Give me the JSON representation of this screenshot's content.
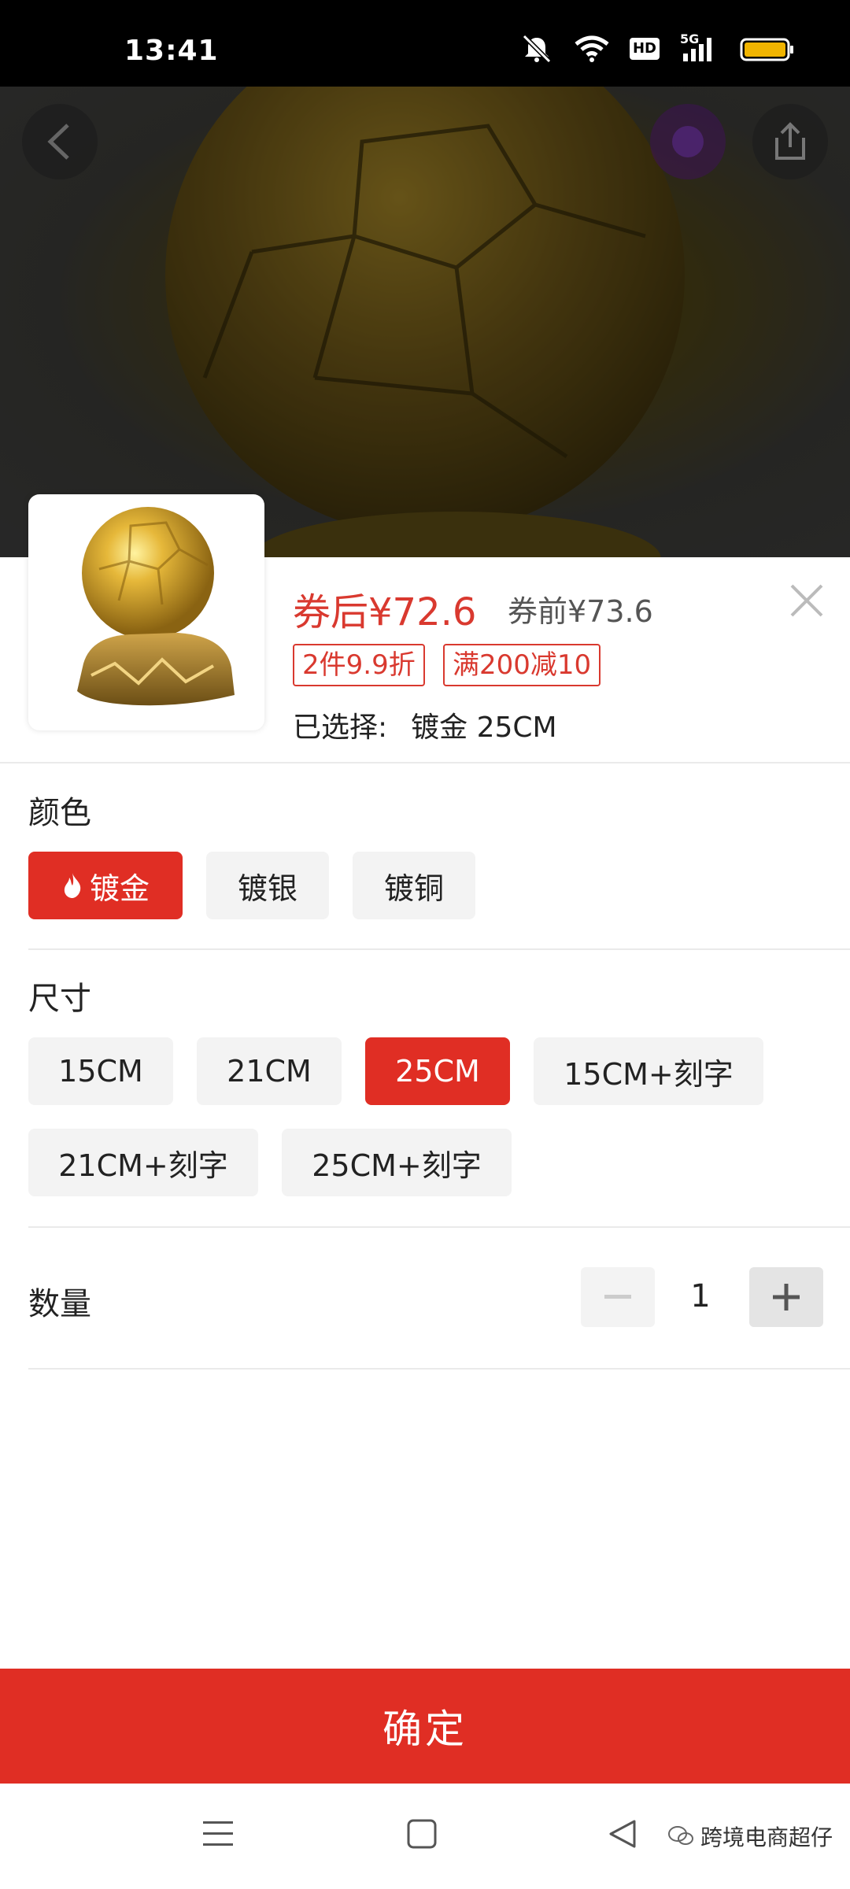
{
  "status_bar": {
    "time": "13:41",
    "icons": [
      "mute-icon",
      "wifi-icon",
      "hd-icon",
      "signal-5g-icon",
      "battery-icon"
    ],
    "hd_label": "HD",
    "net_label": "5G"
  },
  "hero": {
    "icons": [
      "back-icon",
      "brand-icon",
      "share-icon"
    ]
  },
  "product": {
    "price_after": "券后¥72.6",
    "price_before": "券前¥73.6",
    "promos": [
      "2件9.9折",
      "满200减10"
    ],
    "selected_label": "已选择:",
    "selected_value": "镀金 25CM"
  },
  "color_section": {
    "title": "颜色",
    "options": [
      "镀金",
      "镀银",
      "镀铜"
    ],
    "selected": "镀金"
  },
  "size_section": {
    "title": "尺寸",
    "options": [
      "15CM",
      "21CM",
      "25CM",
      "15CM+刻字",
      "21CM+刻字",
      "25CM+刻字"
    ],
    "selected": "25CM"
  },
  "quantity": {
    "label": "数量",
    "value": "1"
  },
  "confirm_label": "确定",
  "nav": {
    "icons": [
      "menu-icon",
      "home-icon",
      "back-triangle-icon"
    ]
  },
  "watermark": "跨境电商超仔",
  "colors": {
    "accent": "#e02e24",
    "price_red": "#d9392f",
    "chip_bg": "#f3f3f3"
  }
}
